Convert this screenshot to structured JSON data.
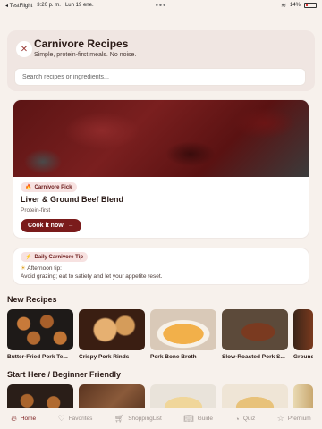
{
  "status": {
    "carrier": "◂ TestFlight",
    "time": "3:20 p. m.",
    "date": "Lun 19 ene.",
    "dots": "•••",
    "battery": "14%"
  },
  "header": {
    "title": "Carnivore Recipes",
    "subtitle": "Simple, protein-first meals. No noise.",
    "search_placeholder": "Search recipes or ingredients..."
  },
  "featured": {
    "badge": "Carnivore Pick",
    "title": "Liver & Ground Beef Blend",
    "subtitle": "Protein-first",
    "button": "Cook it now"
  },
  "tip": {
    "badge": "Daily Carnivore Tip",
    "line1": "Afternoon tip:",
    "line2": "Avoid grazing; eat to satiety and let your appetite reset."
  },
  "sections": {
    "new_title": "New Recipes",
    "beginner_title": "Start Here / Beginner Friendly"
  },
  "new_recipes": [
    {
      "label": "Butter-Fried Pork Te..."
    },
    {
      "label": "Crispy Pork Rinds"
    },
    {
      "label": "Pork Bone Broth"
    },
    {
      "label": "Slow-Roasted Pork S..."
    },
    {
      "label": "Ground"
    }
  ],
  "tabs": [
    {
      "label": "Home",
      "icon": "home-icon"
    },
    {
      "label": "Favorites",
      "icon": "heart-icon"
    },
    {
      "label": "ShoppingList",
      "icon": "cart-icon"
    },
    {
      "label": "Guide",
      "icon": "book-icon"
    },
    {
      "label": "Quiz",
      "icon": "quiz-icon"
    },
    {
      "label": "Premium",
      "icon": "star-icon"
    }
  ],
  "colors": {
    "accent": "#7a1b1b",
    "background": "#f7f1ec",
    "pill_bg": "#f7e2e1"
  }
}
